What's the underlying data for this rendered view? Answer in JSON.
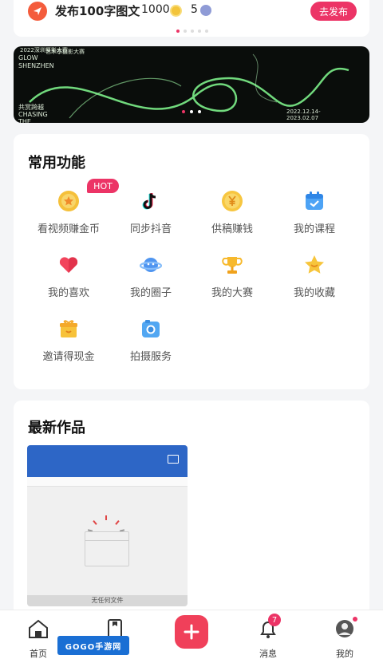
{
  "task": {
    "title": "发布100字图文",
    "coins": "1000",
    "points": "5",
    "button_label": "去发布",
    "icon": "send-icon",
    "accent": "#ec3466"
  },
  "banner": {
    "top_text": "2022深圳摄影大赛",
    "glow_text": "GLOW",
    "shenzhen_text": "SHENZHEN",
    "sub_text": "艺术季摄影大赛",
    "chase_text": "共赏跨越\nCHASING\nTHE",
    "date_text": "2022.12.14-\n2023.02.07"
  },
  "features": {
    "title": "常用功能",
    "hot_badge": "HOT",
    "items": [
      {
        "label": "看视频赚金币",
        "icon": "coin-star-icon"
      },
      {
        "label": "同步抖音",
        "icon": "tiktok-icon"
      },
      {
        "label": "供稿赚钱",
        "icon": "yen-coin-icon"
      },
      {
        "label": "我的课程",
        "icon": "calendar-icon"
      },
      {
        "label": "我的喜欢",
        "icon": "heart-icon"
      },
      {
        "label": "我的圈子",
        "icon": "planet-icon"
      },
      {
        "label": "我的大赛",
        "icon": "trophy-icon"
      },
      {
        "label": "我的收藏",
        "icon": "star-icon"
      },
      {
        "label": "邀请得现金",
        "icon": "gift-icon"
      },
      {
        "label": "拍摄服务",
        "icon": "camera-icon"
      }
    ]
  },
  "works": {
    "title": "最新作品",
    "thumb_caption": "无任何文件"
  },
  "tabbar": {
    "home": "首页",
    "messages": "消息",
    "mine": "我的",
    "message_badge": "7",
    "watermark": "GOGO手游网"
  }
}
